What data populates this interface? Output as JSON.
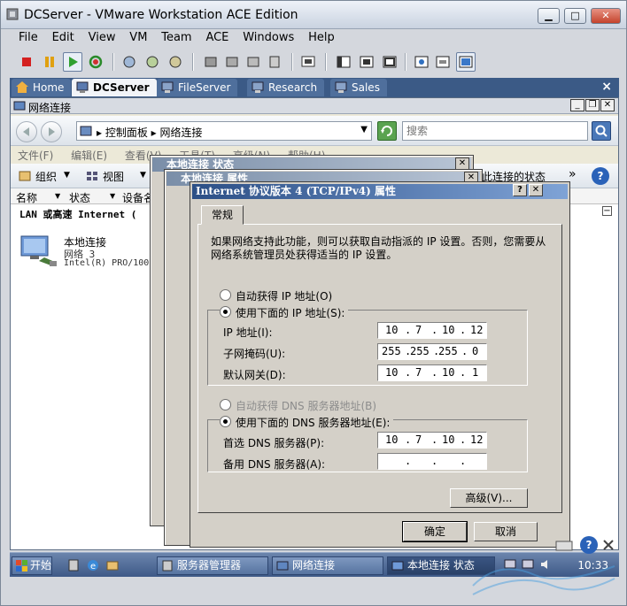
{
  "vmware": {
    "title": "DCServer - VMware Workstation ACE Edition",
    "menu": [
      "File",
      "Edit",
      "View",
      "VM",
      "Team",
      "ACE",
      "Windows",
      "Help"
    ],
    "tabs": [
      {
        "label": "Home",
        "icon": "home-icon"
      },
      {
        "label": "DCServer",
        "icon": "vm-icon",
        "active": true
      },
      {
        "label": "FileServer",
        "icon": "vm-icon"
      },
      {
        "label": "Research",
        "icon": "vm-icon"
      },
      {
        "label": "Sales",
        "icon": "vm-icon"
      }
    ],
    "tabs_close": "×"
  },
  "explorer": {
    "title": "网络连接",
    "breadcrumb": "▸ 控制面板 ▸ 网络连接",
    "search_placeholder": "搜索",
    "menu": [
      "文件(F)",
      "编辑(E)",
      "查看(V)",
      "工具(T)",
      "高级(N)",
      "帮助(H)"
    ],
    "cmd": {
      "organize": "组织",
      "views": "视图",
      "right_text": "此连接的状态"
    },
    "columns": [
      "名称",
      "状态",
      "设备名"
    ],
    "group_header": "LAN 或高速 Internet (",
    "connection": {
      "name": "本地连接",
      "network": "网络  3",
      "device": "Intel(R) PRO/100"
    }
  },
  "dialogs": {
    "status1_title": "本地连接 状态",
    "status2_title": "本地连接 属性"
  },
  "tcpip": {
    "title": "Internet 协议版本 4 (TCP/IPv4) 属性",
    "tab": "常规",
    "intro": "如果网络支持此功能，则可以获取自动指派的 IP 设置。否则，您需要从网络系统管理员处获得适当的 IP 设置。",
    "auto_ip": "自动获得 IP 地址(O)",
    "manual_ip": "使用下面的 IP 地址(S):",
    "ip_label": "IP 地址(I):",
    "mask_label": "子网掩码(U):",
    "gateway_label": "默认网关(D):",
    "ip": [
      "10",
      "7",
      "10",
      "12"
    ],
    "mask": [
      "255",
      "255",
      "255",
      "0"
    ],
    "gateway": [
      "10",
      "7",
      "10",
      "1"
    ],
    "auto_dns": "自动获得 DNS 服务器地址(B)",
    "manual_dns": "使用下面的 DNS 服务器地址(E):",
    "dns1_label": "首选 DNS 服务器(P):",
    "dns2_label": "备用 DNS 服务器(A):",
    "dns1": [
      "10",
      "7",
      "10",
      "12"
    ],
    "dns2": [
      "",
      "",
      "",
      ""
    ],
    "advanced": "高级(V)...",
    "ok": "确定",
    "cancel": "取消"
  },
  "taskbar": {
    "start": "开始",
    "items": [
      "服务器管理器",
      "网络连接",
      "本地连接 状态"
    ],
    "clock": "10:33"
  },
  "colors": {
    "vm_tabbar": "#3b5a86",
    "dialog_title": "#2c4f86",
    "dialog_bg": "#d4d0c8"
  }
}
